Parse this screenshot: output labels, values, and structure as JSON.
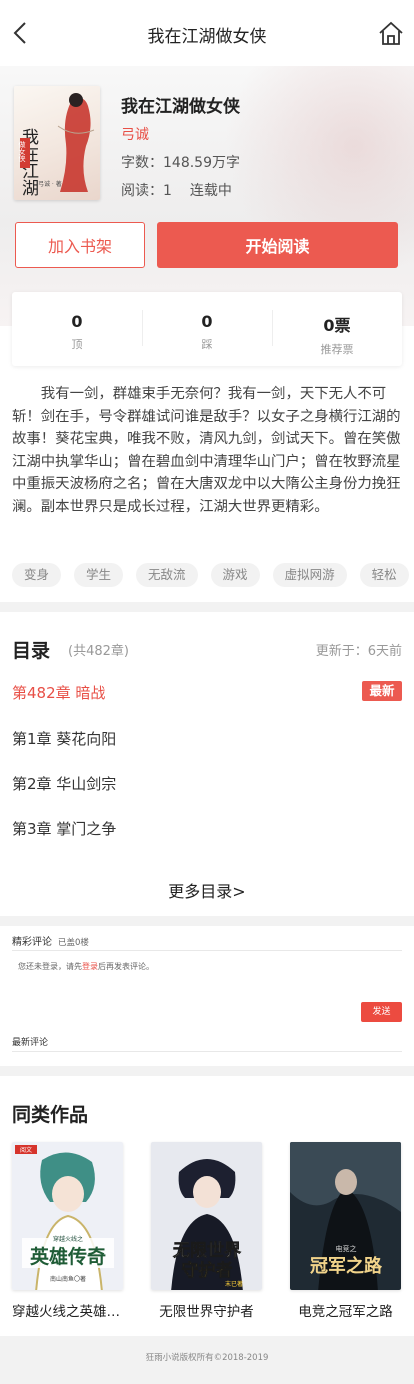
{
  "header": {
    "title": "我在江湖做女侠",
    "back_icon": "chevron-left-icon",
    "home_icon": "home-icon"
  },
  "book": {
    "name": "我在江湖做女侠",
    "author": "弓诚",
    "words": "字数：148.59万字",
    "read": "阅读：1",
    "status": "连载中",
    "cover_title": "我在江湖",
    "cover_badge": "做女侠",
    "cover_author": "弓诚 · 著"
  },
  "actions": {
    "add_shelf": "加入书架",
    "start_read": "开始阅读"
  },
  "stats": [
    {
      "value": "0",
      "label": "顶"
    },
    {
      "value": "0",
      "label": "踩"
    },
    {
      "value": "0票",
      "label": "推荐票"
    }
  ],
  "intro": "我有一剑，群雄束手无奈何？我有一剑，天下无人不可斩！剑在手，号令群雄试问谁是敌手？以女子之身横行江湖的故事！葵花宝典，唯我不败，清风九剑，剑试天下。曾在笑傲江湖中执掌华山；曾在碧血剑中清理华山门户；曾在牧野流星中重振天波杨府之名；曾在大唐双龙中以大隋公主身份力挽狂澜。副本世界只是成长过程，江湖大世界更精彩。",
  "tags": [
    "变身",
    "学生",
    "无敌流",
    "游戏",
    "虚拟网游",
    "轻松"
  ],
  "toc": {
    "title": "目录",
    "count": "(共482章)",
    "updated": "更新于：6天前",
    "latest": "第482章 暗战",
    "new_badge": "最新",
    "chapters": [
      "第1章 葵花向阳",
      "第2章 华山剑宗",
      "第3章 掌门之争"
    ],
    "more": "更多目录>"
  },
  "comments": {
    "title": "精彩评论",
    "count": "已盖0楼",
    "tip_prefix": "您还未登录，请先",
    "tip_link": "登录",
    "tip_suffix": "后再发表评论。",
    "send": "发送",
    "latest": "最新评论"
  },
  "similar": {
    "title": "同类作品",
    "books": [
      {
        "name": "穿越火线之英雄传奇",
        "cover_title": "英雄传奇",
        "cover_sub": "穿越火线之",
        "cover_author": "南山南鱼〇著",
        "corner": "阅文"
      },
      {
        "name": "无限世界守护者",
        "cover_title": "无限世界",
        "cover_sub": "守护者",
        "cover_author": "末已著"
      },
      {
        "name": "电竞之冠军之路",
        "cover_title": "冠军之路",
        "cover_sub": "电竞之"
      }
    ]
  },
  "footer": "狂雨小说版权所有©2018-2019",
  "colors": {
    "accent": "#ec5a50",
    "accent_text": "#e84f46",
    "gray_bg": "#f2f2f2"
  }
}
